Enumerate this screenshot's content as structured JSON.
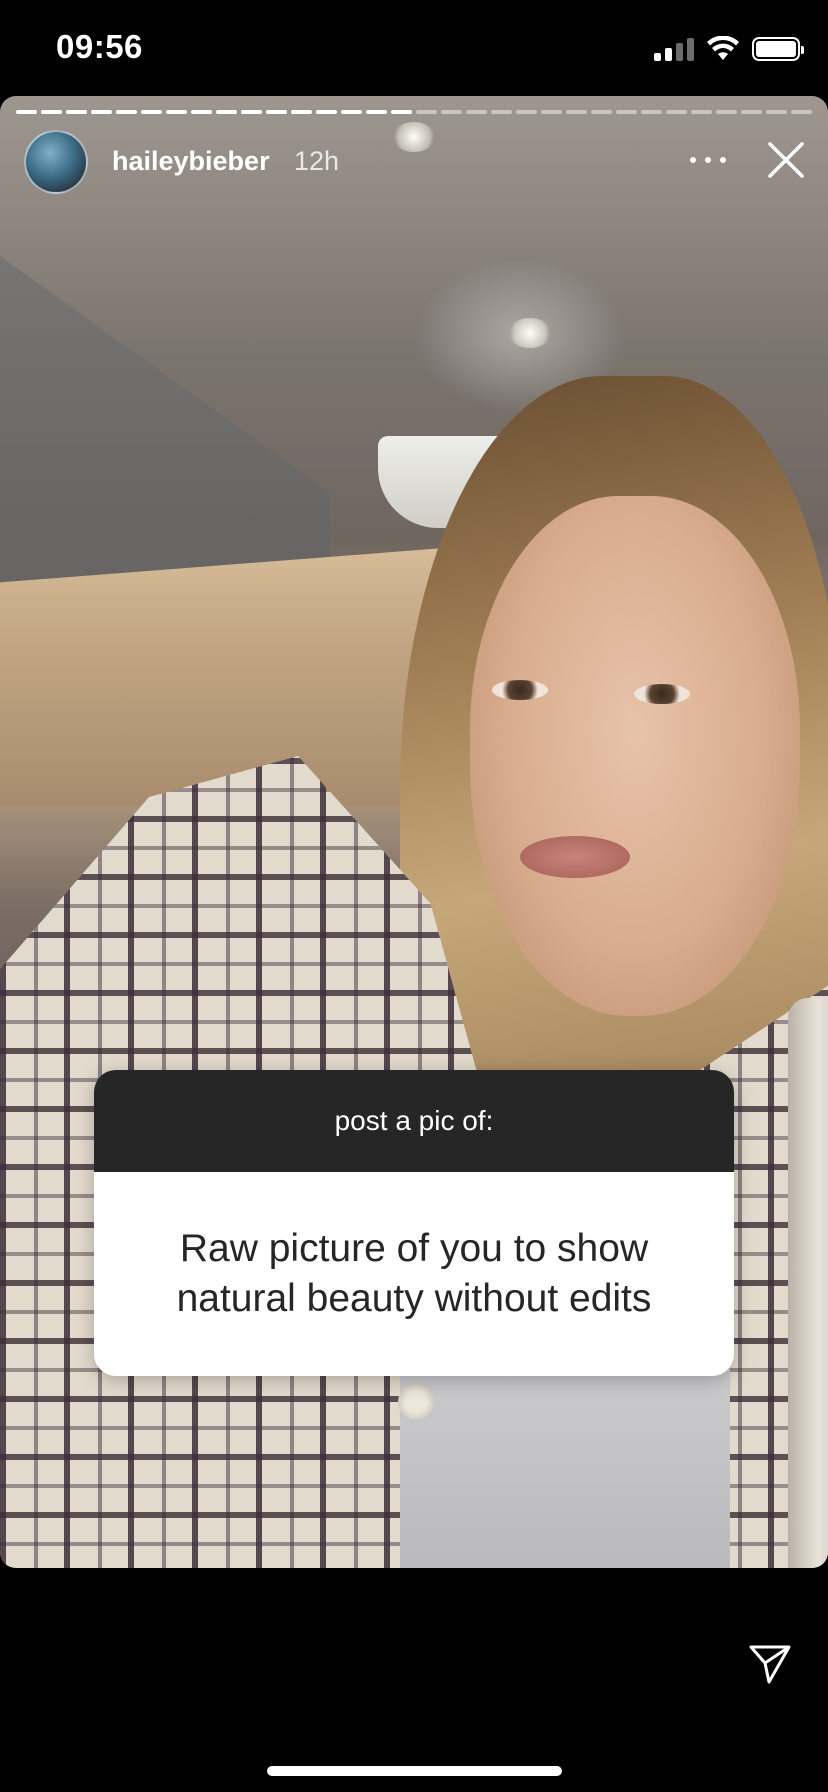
{
  "status_bar": {
    "time": "09:56"
  },
  "story": {
    "username": "haileybieber",
    "time_ago": "12h",
    "progress": {
      "segments": 32,
      "seen": 16
    }
  },
  "question_sticker": {
    "prompt": "post a pic of:",
    "answer": "Raw picture of you to show natural beauty without edits"
  },
  "icons": {
    "more": "more-horizontal-icon",
    "close": "close-icon",
    "send": "paper-plane-icon"
  },
  "colors": {
    "sticker_header": "#262626",
    "sticker_body": "#ffffff",
    "background": "#000000"
  }
}
